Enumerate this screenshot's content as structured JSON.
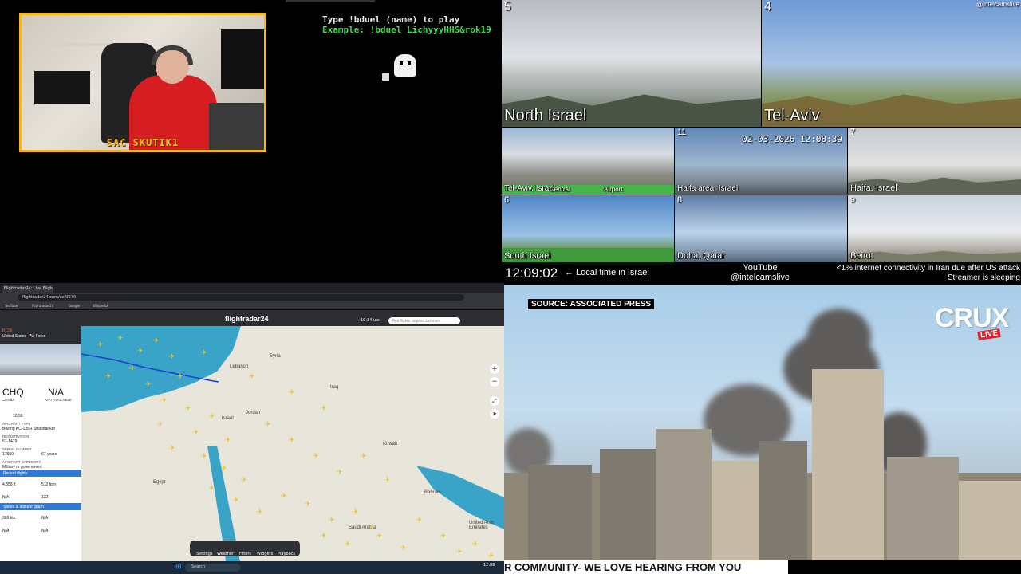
{
  "webcam": {
    "streamer_name": "SAC SKUTIK1"
  },
  "game": {
    "instruction": "Type !bduel (name) to play",
    "example": "Example: !bduel LichyyyHHS&rok19"
  },
  "cameras": [
    {
      "number": "5",
      "label": "North Israel"
    },
    {
      "number": "4",
      "label": "Tel-Aviv"
    },
    {
      "number": "",
      "label": "Tel-Aviv, Israel",
      "extra": [
        "Central",
        "Airport"
      ]
    },
    {
      "number": "11",
      "label": "Haifa area, Israel",
      "timestamp": "02-03-2026 12:08:39"
    },
    {
      "number": "7",
      "label": "Haifa, Israel"
    },
    {
      "number": "6",
      "label": "South Israel"
    },
    {
      "number": "8",
      "label": "Doha, Qatar"
    },
    {
      "number": "9",
      "label": "Beirut"
    }
  ],
  "camera_handle": "@intelcamslive",
  "footer": {
    "clock": "12:09:02",
    "clock_caption": "← Local time in Israel",
    "youtube_line1": "YouTube",
    "youtube_line2": "@intelcamslive",
    "notice_line1": "<1% internet connectivity in Iran due after US attack",
    "notice_line2": "Streamer is sleeping"
  },
  "browser": {
    "tab_title": "Flightradar24: Live Flight Tracker",
    "url": "flightradar24.com/ae6f270",
    "bookmarks": [
      "YouTube",
      "Flightradar24",
      "Google",
      "Wikipedia"
    ],
    "logo": "flightradar24",
    "clock": "10:34 utc",
    "search_placeholder": "Find flights, airports and more",
    "info": {
      "operator": "United States - Air Force",
      "aircraft_code": "KC35",
      "callsign": "CHQ",
      "destination": "N/A",
      "origin_sub": "CHABA",
      "dest_sub": "NOT AVAILABLE",
      "time": "10:56",
      "aircraft_type_label": "AIRCRAFT TYPE",
      "aircraft_type": "Boeing KC-135R Stratotanker",
      "registration_label": "REGISTRATION",
      "registration": "57-1479",
      "serial_label": "SERIAL NUMBER",
      "serial": "17550",
      "age": "67 years",
      "category_label": "AIRCRAFT CATEGORY",
      "category": "Military or government",
      "band1": "Recent flights",
      "baro_alt": "4,359 ft",
      "vert_speed": "512 fpm",
      "gps_alt": "N/A",
      "track": "132°",
      "band2": "Speed & altitude graph",
      "ground_speed": "380 kts",
      "true_airspeed": "N/A",
      "indicated_airspeed": "N/A",
      "mach": "N/A"
    },
    "map_labels": [
      "Syria",
      "Iraq",
      "Lebanon",
      "Israel",
      "Jordan",
      "Kuwait",
      "Egypt",
      "Bahrain",
      "Saudi Arabia",
      "United Arab Emirates"
    ],
    "toolbar": [
      "Settings",
      "Weather",
      "Filters",
      "Widgets",
      "Playback"
    ],
    "taskbar_search": "Search",
    "taskbar_time": "12:08"
  },
  "news": {
    "source": "SOURCE: ASSOCIATED PRESS",
    "brand": "CRUX",
    "brand_live": "LIVE",
    "ticker": "R COMMUNITY- WE LOVE HEARING FROM YOU"
  }
}
